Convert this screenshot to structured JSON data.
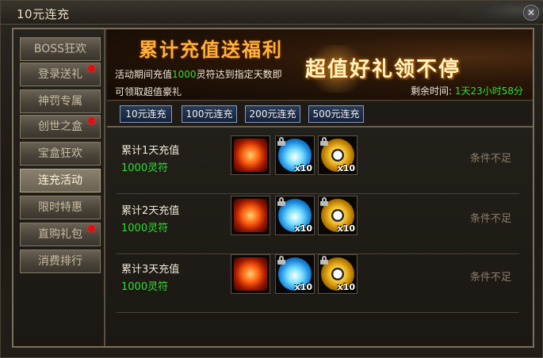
{
  "window": {
    "title": "10元连充",
    "close_icon": "close-icon"
  },
  "sidebar": {
    "items": [
      {
        "label": "BOSS狂欢",
        "badge": false,
        "active": false
      },
      {
        "label": "登录送礼",
        "badge": true,
        "active": false
      },
      {
        "label": "神罚专属",
        "badge": false,
        "active": false
      },
      {
        "label": "创世之盒",
        "badge": true,
        "active": false
      },
      {
        "label": "宝盒狂欢",
        "badge": false,
        "active": false
      },
      {
        "label": "连充活动",
        "badge": false,
        "active": true
      },
      {
        "label": "限时特惠",
        "badge": false,
        "active": false
      },
      {
        "label": "直购礼包",
        "badge": true,
        "active": false
      },
      {
        "label": "消费排行",
        "badge": false,
        "active": false
      }
    ]
  },
  "banner": {
    "title": "累计充值送福利",
    "slogan": "超值好礼领不停",
    "desc_prefix": "活动期间充值",
    "desc_amount": "1000",
    "desc_suffix": "灵符达到指定天数即",
    "desc_line2": "可领取超值豪礼",
    "remaining_label": "剩余时间:",
    "remaining_value": "1天23小时58分"
  },
  "tabs": [
    "10元连充",
    "100元连充",
    "200元连充",
    "500元连充"
  ],
  "rows": [
    {
      "title": "累计1天充值",
      "reward": "1000灵符",
      "status": "条件不足",
      "items": [
        {
          "icon": "fire-crest-icon",
          "qty": "",
          "locked": false
        },
        {
          "icon": "blue-flame-icon",
          "qty": "x10",
          "locked": true
        },
        {
          "icon": "gold-gear-token-icon",
          "qty": "x10",
          "locked": true
        }
      ]
    },
    {
      "title": "累计2天充值",
      "reward": "1000灵符",
      "status": "条件不足",
      "items": [
        {
          "icon": "fire-crest-icon",
          "qty": "",
          "locked": false
        },
        {
          "icon": "blue-flame-icon",
          "qty": "x10",
          "locked": true
        },
        {
          "icon": "gold-gear-token-icon",
          "qty": "x10",
          "locked": true
        }
      ]
    },
    {
      "title": "累计3天充值",
      "reward": "1000灵符",
      "status": "条件不足",
      "items": [
        {
          "icon": "fire-crest-icon",
          "qty": "",
          "locked": false
        },
        {
          "icon": "blue-flame-icon",
          "qty": "x10",
          "locked": true
        },
        {
          "icon": "gold-gear-token-icon",
          "qty": "x10",
          "locked": true
        }
      ]
    }
  ],
  "colors": {
    "highlight_green": "#2ee02e",
    "status_gray": "#8a7d66",
    "badge_red": "#e01010",
    "banner_gold": "#ffb13a"
  }
}
